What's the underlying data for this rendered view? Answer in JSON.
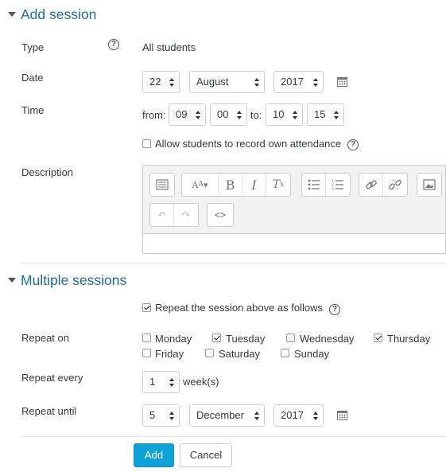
{
  "add_session": {
    "title": "Add session",
    "type_label": "Type",
    "type_value": "All students",
    "date_label": "Date",
    "date_day": "22",
    "date_month": "August",
    "date_year": "2017",
    "time_label": "Time",
    "from_label": "from:",
    "from_hour": "09",
    "from_minute": "00",
    "to_label": "to:",
    "to_hour": "10",
    "to_minute": "15",
    "allow_self_label": "Allow students to record own attendance",
    "allow_self_checked": false,
    "description_label": "Description",
    "description_value": ""
  },
  "editor_toolbar": {
    "row1": [
      "toolbar-toggle",
      "font-style",
      "bold",
      "italic",
      "clear-format",
      "unordered-list",
      "ordered-list",
      "link",
      "unlink",
      "image"
    ],
    "row2": [
      "undo",
      "redo",
      "html-source"
    ]
  },
  "multiple_sessions": {
    "title": "Multiple sessions",
    "repeat_label": "Repeat the session above as follows",
    "repeat_checked": true,
    "repeat_on_label": "Repeat on",
    "days": [
      {
        "label": "Monday",
        "checked": false
      },
      {
        "label": "Tuesday",
        "checked": true
      },
      {
        "label": "Wednesday",
        "checked": false
      },
      {
        "label": "Thursday",
        "checked": true
      },
      {
        "label": "Friday",
        "checked": false
      },
      {
        "label": "Saturday",
        "checked": false
      },
      {
        "label": "Sunday",
        "checked": false
      }
    ],
    "repeat_every_label": "Repeat every",
    "repeat_every_value": "1",
    "repeat_every_unit": "week(s)",
    "repeat_until_label": "Repeat until",
    "until_day": "5",
    "until_month": "December",
    "until_year": "2017"
  },
  "actions": {
    "add_label": "Add",
    "cancel_label": "Cancel"
  },
  "colors": {
    "heading": "#1f6d93",
    "primary_button": "#0fa2d6"
  }
}
